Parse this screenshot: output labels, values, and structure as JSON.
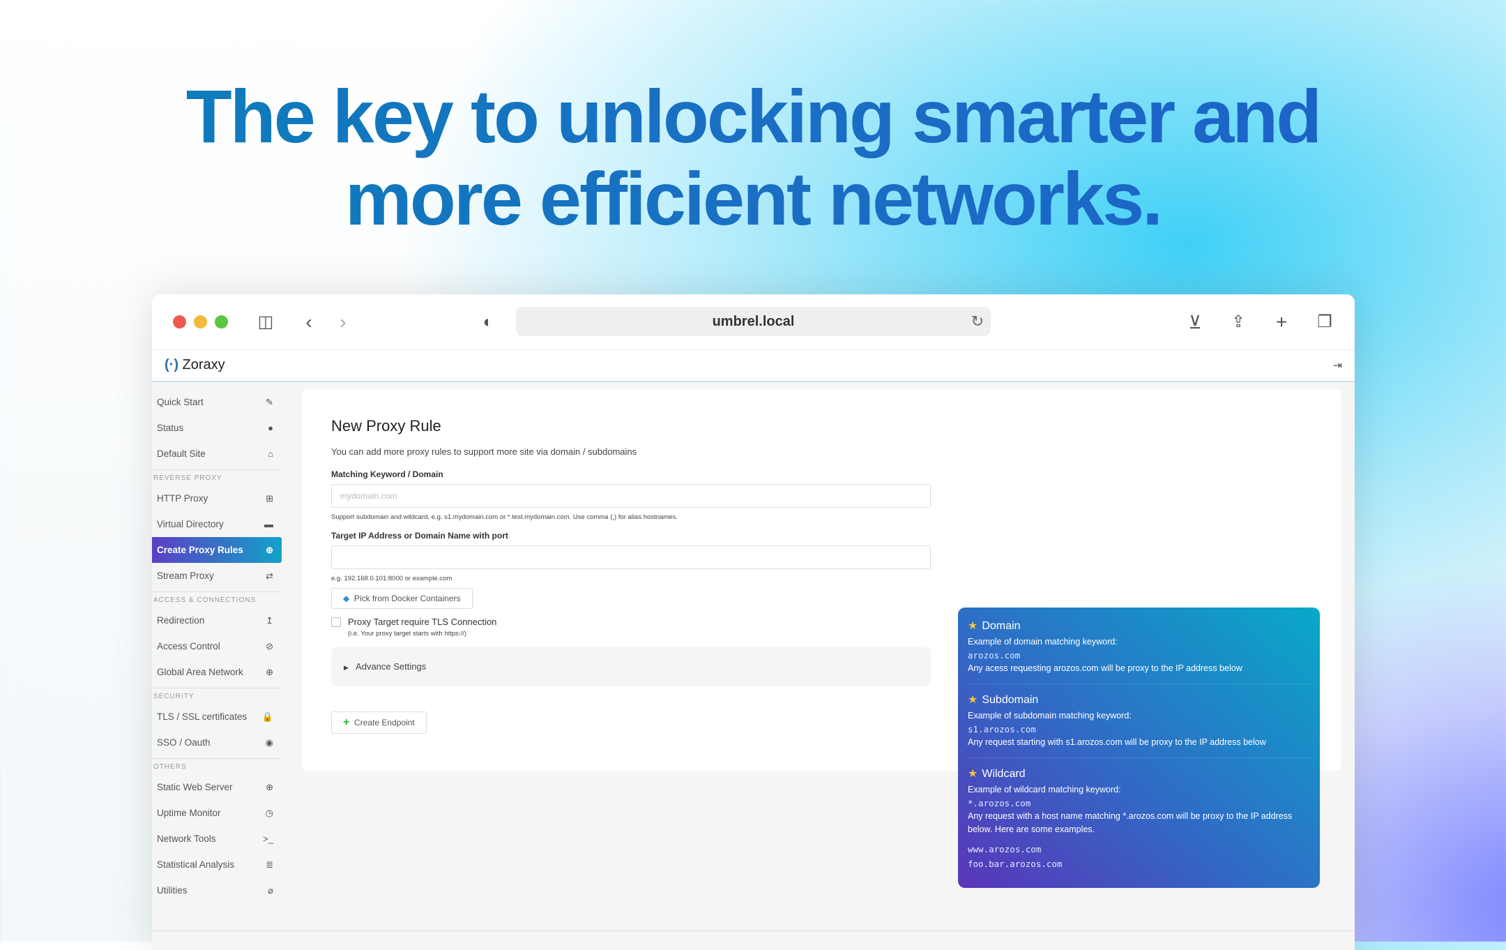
{
  "headline": {
    "line1": "The key to unlocking smarter and",
    "line2": "more efficient networks."
  },
  "browser": {
    "url": "umbrel.local"
  },
  "app": {
    "name": "Zoraxy"
  },
  "sidebar": {
    "groups": [
      {
        "title": "",
        "items": [
          {
            "label": "Quick Start",
            "icon": "✎"
          },
          {
            "label": "Status",
            "icon": "●"
          },
          {
            "label": "Default Site",
            "icon": "⌂"
          }
        ]
      },
      {
        "title": "REVERSE PROXY",
        "items": [
          {
            "label": "HTTP Proxy",
            "icon": "⊞"
          },
          {
            "label": "Virtual Directory",
            "icon": "▬"
          },
          {
            "label": "Create Proxy Rules",
            "icon": "⊕",
            "active": true
          },
          {
            "label": "Stream Proxy",
            "icon": "⇄"
          }
        ]
      },
      {
        "title": "ACCESS & CONNECTIONS",
        "items": [
          {
            "label": "Redirection",
            "icon": "↥"
          },
          {
            "label": "Access Control",
            "icon": "⊘"
          },
          {
            "label": "Global Area Network",
            "icon": "⊕"
          }
        ]
      },
      {
        "title": "SECURITY",
        "items": [
          {
            "label": "TLS / SSL certificates",
            "icon": "🔒"
          },
          {
            "label": "SSO / Oauth",
            "icon": "◉"
          }
        ]
      },
      {
        "title": "OTHERS",
        "items": [
          {
            "label": "Static Web Server",
            "icon": "⊕"
          },
          {
            "label": "Uptime Monitor",
            "icon": "◷"
          },
          {
            "label": "Network Tools",
            "icon": ">_"
          },
          {
            "label": "Statistical Analysis",
            "icon": "≣"
          },
          {
            "label": "Utilities",
            "icon": "⌀"
          }
        ]
      }
    ]
  },
  "form": {
    "title": "New Proxy Rule",
    "description": "You can add more proxy rules to support more site via domain / subdomains",
    "domain_label": "Matching Keyword / Domain",
    "domain_placeholder": "mydomain.com",
    "domain_hint": "Support subdomain and wildcard, e.g. s1.mydomain.com or *.test.mydomain.com. Use comma (,) for alias hostnames.",
    "target_label": "Target IP Address or Domain Name with port",
    "target_value": "",
    "target_hint": "e.g. 192.168.0.101:8000 or example.com",
    "docker_button": "Pick from Docker Containers",
    "tls_label": "Proxy Target require TLS Connection",
    "tls_hint": "(i.e. Your proxy target starts with https://)",
    "tls_checked": false,
    "advance": "Advance Settings",
    "create_button": "Create Endpoint"
  },
  "info": {
    "sections": [
      {
        "title": "Domain",
        "line1": "Example of domain matching keyword:",
        "code": "arozos.com",
        "line2": "Any acess requesting arozos.com will be proxy to the IP address below"
      },
      {
        "title": "Subdomain",
        "line1": "Example of subdomain matching keyword:",
        "code": "s1.arozos.com",
        "line2": "Any request starting with s1.arozos.com will be proxy to the IP address below"
      },
      {
        "title": "Wildcard",
        "line1": "Example of wildcard matching keyword:",
        "code": "*.arozos.com",
        "line2": "Any request with a host name matching *.arozos.com will be proxy to the IP address below. Here are some examples.",
        "examples": [
          "www.arozos.com",
          "foo.bar.arozos.com"
        ]
      }
    ]
  },
  "colors": {
    "accent_start": "#5b3fc4",
    "accent_end": "#12a3c9",
    "headline": "#0a7fb8",
    "star": "#f6c23e"
  }
}
